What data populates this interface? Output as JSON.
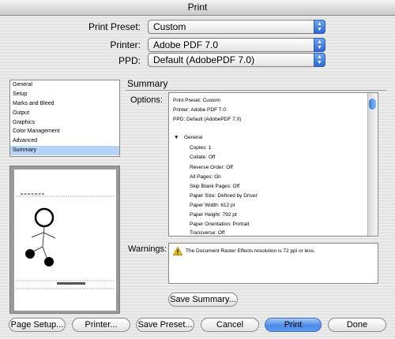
{
  "window": {
    "title": "Print"
  },
  "presets": {
    "print_preset_label": "Print Preset:",
    "print_preset_value": "Custom",
    "printer_label": "Printer:",
    "printer_value": "Adobe PDF 7.0",
    "ppd_label": "PPD:",
    "ppd_value": "Default (AdobePDF 7.0)"
  },
  "categories": [
    {
      "label": "General",
      "selected": false
    },
    {
      "label": "Setup",
      "selected": false
    },
    {
      "label": "Marks and Bleed",
      "selected": false
    },
    {
      "label": "Output",
      "selected": false
    },
    {
      "label": "Graphics",
      "selected": false
    },
    {
      "label": "Color Management",
      "selected": false
    },
    {
      "label": "Advanced",
      "selected": false
    },
    {
      "label": "Summary",
      "selected": true
    }
  ],
  "summary": {
    "title": "Summary",
    "options_label": "Options:",
    "lines": [
      "Print Preset: Custom",
      "Printer: Adobe PDF 7.0",
      "PPD: Default (AdobePDF 7.0)",
      "General",
      "Copies: 1",
      "Collate: Off",
      "Reverse Order: Off",
      "All Pages: On",
      "Skip Blank Pages: Off",
      "Paper Size: Defined by Driver",
      "Paper Width: 612 pt",
      "Paper Height: 792 pt",
      "Paper Orientation: Portrait",
      "Transverse: Off"
    ],
    "warnings_label": "Warnings:",
    "warning_text": "The Document Raster Effects resolution is 72 ppi or less.",
    "save_summary_label": "Save Summary..."
  },
  "buttons": {
    "page_setup": "Page Setup...",
    "printer": "Printer...",
    "save_preset": "Save Preset...",
    "cancel": "Cancel",
    "print": "Print",
    "done": "Done"
  },
  "colors": {
    "selection": "#b4d3f6",
    "default_button": "#4d8be8",
    "warning_icon": "#f2c200"
  }
}
